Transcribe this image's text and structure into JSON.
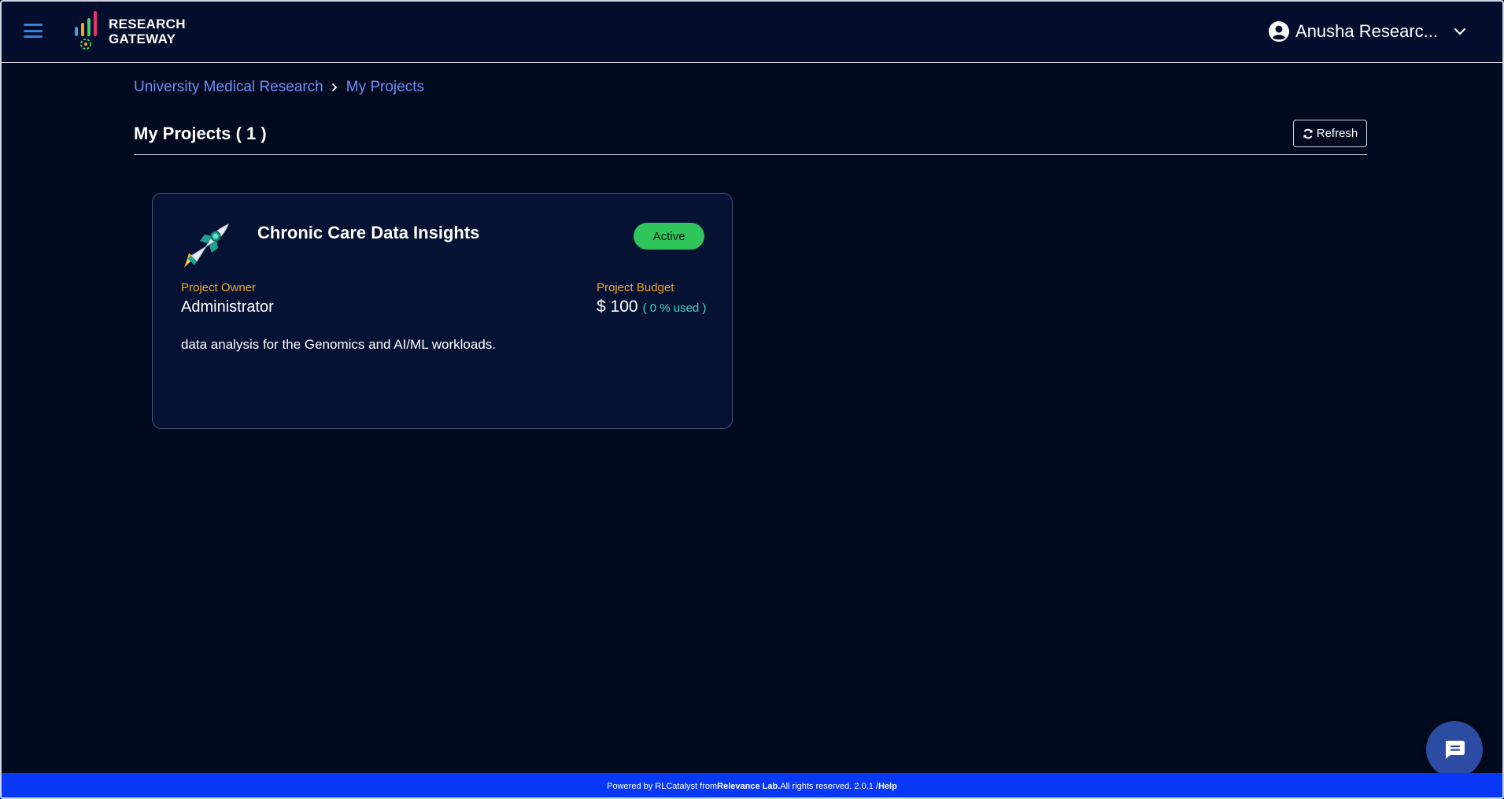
{
  "header": {
    "logo_line1": "RESEARCH",
    "logo_line2": "GATEWAY",
    "user_name": "Anusha Researc...",
    "icons": {
      "menu": "hamburger-menu-icon",
      "user": "user-circle-icon",
      "dropdown": "chevron-down-icon"
    }
  },
  "breadcrumb": {
    "items": [
      {
        "label": "University Medical Research"
      },
      {
        "label": "My Projects"
      }
    ],
    "separator_icon": "chevron-right-icon"
  },
  "page": {
    "title": "My Projects ( 1 )",
    "refresh_label": "Refresh",
    "refresh_icon": "refresh-icon"
  },
  "projects": [
    {
      "name": "Chronic Care Data Insights",
      "status": "Active",
      "owner_label": "Project Owner",
      "owner": "Administrator",
      "budget_label": "Project Budget",
      "budget": "$ 100",
      "budget_used": "( 0 % used )",
      "description": "data analysis for the Genomics and AI/ML workloads.",
      "icon": "rocket-icon"
    }
  ],
  "chat": {
    "icon": "chat-bubble-icon"
  },
  "footer": {
    "prefix": "Powered by RLCatalyst from ",
    "company": "Relevance Lab.",
    "suffix": " All rights reserved. 2.0.1 / ",
    "help": "Help"
  },
  "colors": {
    "background": "#020a1f",
    "header": "#040d2b",
    "link": "#6f8ef5",
    "accent_label": "#f0a526",
    "status_active": "#2fc55a",
    "budget_used": "#3fd8c4",
    "footer": "#0638f5"
  }
}
